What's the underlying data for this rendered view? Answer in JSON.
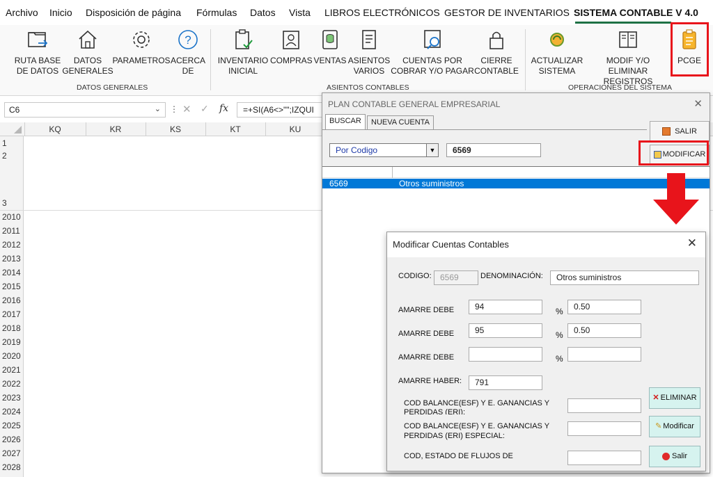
{
  "menu": {
    "items": [
      "Archivo",
      "Inicio",
      "Disposición de página",
      "Fórmulas",
      "Datos",
      "Vista",
      "LIBROS ELECTRÓNICOS",
      "GESTOR DE INVENTARIOS",
      "SISTEMA CONTABLE V 4.0"
    ]
  },
  "ribbon": {
    "buttons": [
      {
        "l1": "RUTA BASE",
        "l2": "DE DATOS",
        "icon": "folder-path-icon"
      },
      {
        "l1": "DATOS",
        "l2": "GENERALES",
        "icon": "home-icon"
      },
      {
        "l1": "PARAMETROS",
        "l2": "",
        "icon": "gear-icon"
      },
      {
        "l1": "ACERCA",
        "l2": "DE",
        "icon": "help-icon"
      },
      {
        "l1": "INVENTARIO",
        "l2": "INICIAL",
        "icon": "clipboard-check-icon"
      },
      {
        "l1": "COMPRAS",
        "l2": "",
        "icon": "contact-card-icon"
      },
      {
        "l1": "VENTAS",
        "l2": "",
        "icon": "database-icon"
      },
      {
        "l1": "ASIENTOS",
        "l2": "VARIOS",
        "icon": "document-icon"
      },
      {
        "l1": "CUENTAS POR",
        "l2": "COBRAR Y/O PAGAR",
        "icon": "people-search-icon"
      },
      {
        "l1": "CIERRE",
        "l2": "CONTABLE",
        "icon": "lock-icon"
      },
      {
        "l1": "ACTUALIZAR",
        "l2": "SISTEMA",
        "icon": "refresh-gear-icon"
      },
      {
        "l1": "MODIF Y/O",
        "l2": "ELIMINAR REGISTROS",
        "icon": "book-icon"
      },
      {
        "l1": "PCGE",
        "l2": "",
        "icon": "clipboard-gear-icon"
      }
    ],
    "groups": [
      "DATOS GENERALES",
      "ASIENTOS CONTABLES",
      "OPERACIONES DEL SISTEMA"
    ]
  },
  "formula_bar": {
    "namebox": "C6",
    "formula": "=+SI(A6<>\"\";IZQUI"
  },
  "grid": {
    "columns": [
      "KQ",
      "KR",
      "KS",
      "KT",
      "KU"
    ],
    "rows": [
      "1",
      "2",
      "3",
      "2010",
      "2011",
      "2012",
      "2013",
      "2014",
      "2015",
      "2016",
      "2017",
      "2018",
      "2019",
      "2020",
      "2021",
      "2022",
      "2023",
      "2024",
      "2025",
      "2026",
      "2027",
      "2028"
    ]
  },
  "pcge_dialog": {
    "title": "PLAN CONTABLE GENERAL EMPRESARIAL",
    "tabs": [
      "BUSCAR",
      "NUEVA CUENTA"
    ],
    "search_type": "Por Codigo",
    "search_value": "6569",
    "salir_label": "SALIR",
    "modificar_label": "MODIFICAR",
    "results": [
      {
        "code": "6569",
        "name": "Otros suministros"
      }
    ]
  },
  "mod_dialog": {
    "title": "Modificar Cuentas Contables",
    "codigo_label": "CODIGO:",
    "codigo_value": "6569",
    "denominacion_label": "DENOMINACIÓN:",
    "denominacion_value": "Otros suministros",
    "amarre_debe_label": "AMARRE DEBE",
    "amarres_debe": [
      {
        "cuenta": "94",
        "pct": "0.50"
      },
      {
        "cuenta": "95",
        "pct": "0.50"
      },
      {
        "cuenta": "",
        "pct": ""
      }
    ],
    "pct_symbol": "%",
    "amarre_haber_label": "AMARRE HABER:",
    "amarre_haber_value": "791",
    "cod_balance_1a": "COD BALANCE(ESF) Y E. GANANCIAS Y",
    "cod_balance_1b": "PERDIDAS (ERI):",
    "cod_balance_2a": "COD BALANCE(ESF) Y E. GANANCIAS Y",
    "cod_balance_2b": "PERDIDAS (ERI) ESPECIAL:",
    "cod_flujos": "COD, ESTADO DE FLUJOS DE",
    "eliminar_label": "ELIMINAR",
    "modificar_label": "Modificar",
    "salir_label": "Salir"
  }
}
